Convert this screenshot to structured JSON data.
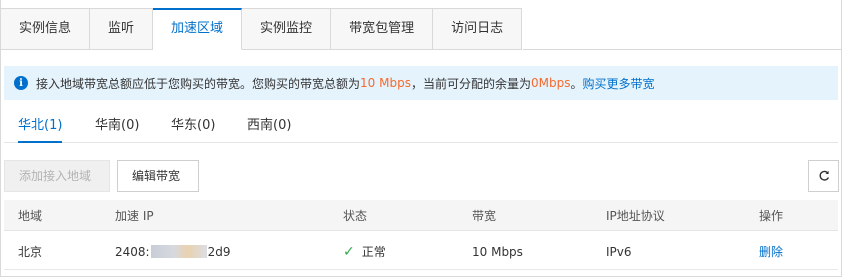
{
  "tabs": [
    {
      "label": "实例信息"
    },
    {
      "label": "监听"
    },
    {
      "label": "加速区域",
      "active": true
    },
    {
      "label": "实例监控"
    },
    {
      "label": "带宽包管理"
    },
    {
      "label": "访问日志"
    }
  ],
  "alert": {
    "icon": "info-icon",
    "text_before": "接入地域带宽总额应低于您购买的带宽。您购买的带宽总额为",
    "total_bandwidth": "10 Mbps",
    "text_middle": "，当前可分配的余量为",
    "remaining": "0Mbps",
    "text_after": "。",
    "link": "购买更多带宽"
  },
  "region_tabs": [
    {
      "label": "华北(1)",
      "active": true
    },
    {
      "label": "华南(0)"
    },
    {
      "label": "华东(0)"
    },
    {
      "label": "西南(0)"
    }
  ],
  "toolbar": {
    "add_label": "添加接入地域",
    "edit_label": "编辑带宽",
    "refresh_icon": "refresh-icon"
  },
  "table": {
    "columns": [
      "地域",
      "加速 IP",
      "状态",
      "带宽",
      "IP地址协议",
      "操作"
    ],
    "rows": [
      {
        "region": "北京",
        "ip_prefix": "2408:",
        "ip_suffix": "2d9",
        "status": "正常",
        "bandwidth": "10 Mbps",
        "protocol": "IPv6",
        "action": "删除"
      }
    ]
  },
  "colors": {
    "accent": "#0070cc",
    "highlight": "#f56a2e",
    "alert_bg": "#e5f3fd",
    "success": "#2fa84f"
  }
}
